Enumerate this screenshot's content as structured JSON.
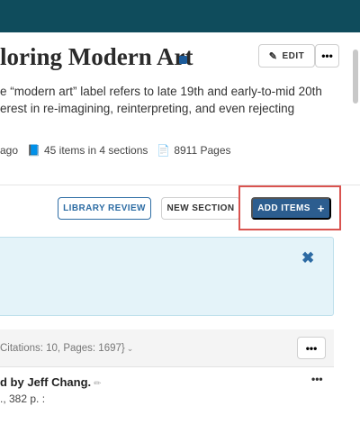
{
  "header": {
    "bar_color": "#0f4c5c"
  },
  "list": {
    "title": "loring Modern Art",
    "edit_label": "EDIT",
    "more_label": "•••",
    "description_lines": [
      "e “modern art” label refers to late 19th and early-to-mid 20th",
      "erest in re-imagining, reinterpreting, and even rejecting"
    ],
    "meta": {
      "updated": "ago",
      "items": "45 items in 4 sections",
      "pages": "8911 Pages"
    }
  },
  "actions": {
    "library_review": "LIBRARY REVIEW",
    "new_section": "NEW SECTION",
    "add_items": "ADD ITEMS",
    "add_icon": "+"
  },
  "notice": {
    "close_icon": "✖"
  },
  "section": {
    "summary": "Citations: 10, Pages: 1697}",
    "more_label": "•••"
  },
  "item": {
    "title": "d by Jeff Chang.",
    "subtitle": "., 382 p. :",
    "more_label": "•••"
  },
  "icons": {
    "edit": "pencil-icon",
    "items": "book-icon",
    "pages": "pages-icon",
    "close": "close-icon",
    "add": "plus-icon"
  },
  "colors": {
    "primary": "#2c5d8f",
    "accent_outline": "#2e6da4",
    "highlight": "#d9534f",
    "notice_bg": "#e4f3f9"
  }
}
